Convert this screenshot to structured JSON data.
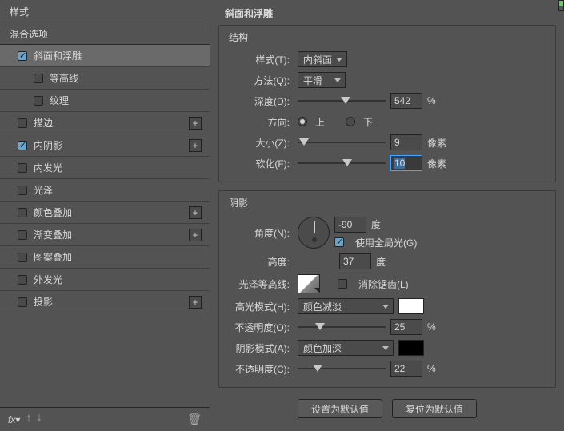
{
  "left": {
    "header": "样式",
    "blendTitle": "混合选项",
    "items": [
      {
        "label": "斜面和浮雕",
        "checked": true,
        "active": true,
        "add": false
      },
      {
        "label": "等高线",
        "checked": false,
        "sub": true,
        "add": false
      },
      {
        "label": "纹理",
        "checked": false,
        "sub": true,
        "add": false
      },
      {
        "label": "描边",
        "checked": false,
        "add": true
      },
      {
        "label": "内阴影",
        "checked": true,
        "add": true
      },
      {
        "label": "内发光",
        "checked": false,
        "add": false
      },
      {
        "label": "光泽",
        "checked": false,
        "add": false
      },
      {
        "label": "颜色叠加",
        "checked": false,
        "add": true
      },
      {
        "label": "渐变叠加",
        "checked": false,
        "add": true
      },
      {
        "label": "图案叠加",
        "checked": false,
        "add": false
      },
      {
        "label": "外发光",
        "checked": false,
        "add": false
      },
      {
        "label": "投影",
        "checked": false,
        "add": true
      }
    ],
    "fx": "fx"
  },
  "panel": {
    "title": "斜面和浮雕",
    "structure": {
      "title": "结构",
      "styleLabel": "样式(T):",
      "styleValue": "内斜面",
      "methodLabel": "方法(Q):",
      "methodValue": "平滑",
      "depthLabel": "深度(D):",
      "depthValue": "542",
      "depthUnit": "%",
      "directionLabel": "方向:",
      "up": "上",
      "down": "下",
      "sizeLabel": "大小(Z):",
      "sizeValue": "9",
      "sizeUnit": "像素",
      "softenLabel": "软化(F):",
      "softenValue": "10",
      "softenUnit": "像素"
    },
    "shading": {
      "title": "阴影",
      "angleLabel": "角度(N):",
      "angleValue": "-90",
      "angleUnit": "度",
      "globalLight": "使用全局光(G)",
      "altitudeLabel": "高度:",
      "altitudeValue": "37",
      "altitudeUnit": "度",
      "contourLabel": "光泽等高线:",
      "antialias": "消除锯齿(L)",
      "hiModeLabel": "高光模式(H):",
      "hiModeValue": "颜色减淡",
      "hiOpacityLabel": "不透明度(O):",
      "hiOpacityValue": "25",
      "hiOpacityUnit": "%",
      "shModeLabel": "阴影模式(A):",
      "shModeValue": "颜色加深",
      "shOpacityLabel": "不透明度(C):",
      "shOpacityValue": "22",
      "shOpacityUnit": "%"
    },
    "buttons": {
      "default": "设置为默认值",
      "reset": "复位为默认值"
    }
  }
}
